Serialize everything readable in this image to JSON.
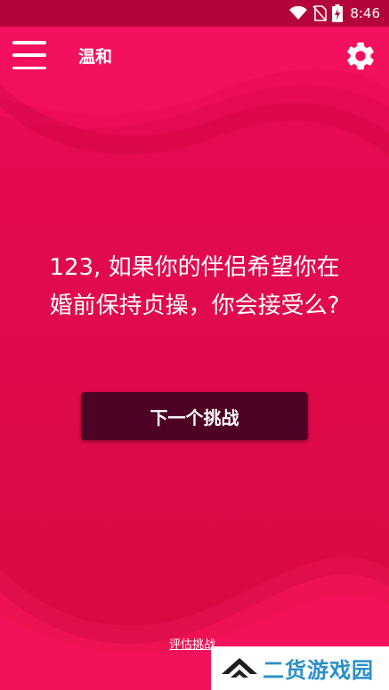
{
  "status_bar": {
    "time": "8:46",
    "icons": [
      "wifi-icon",
      "no-sim-icon",
      "battery-charging-icon"
    ]
  },
  "app_bar": {
    "title": "温和",
    "menu_icon": "hamburger-menu-icon",
    "settings_icon": "gear-icon"
  },
  "main": {
    "question_line1": "123, 如果你的伴侣希望你在",
    "question_line2": "婚前保持贞操，你会接受么?",
    "next_button_label": "下一个挑战",
    "rate_link_label": "评估挑战"
  },
  "watermark": {
    "text": "二货游戏园",
    "logo_icon": "chevron-logo-icon"
  },
  "colors": {
    "background": "#e5084f",
    "status_bar": "#b4053b",
    "button": "#4e0225",
    "watermark_text": "#2a8fc9"
  }
}
